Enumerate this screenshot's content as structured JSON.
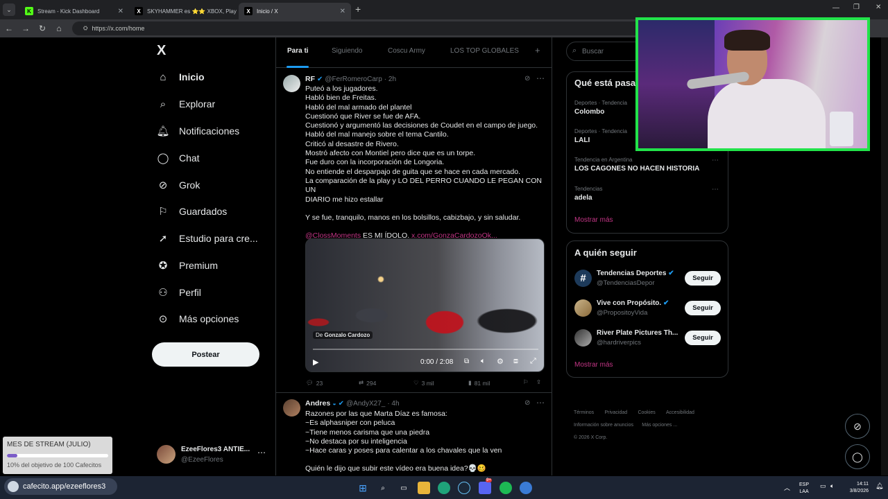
{
  "browser": {
    "tabs": [
      {
        "title": "Stream - Kick Dashboard",
        "icon": "kick-icon",
        "active": false
      },
      {
        "title": "SKYHAMMER es ⭐⭐ XBOX, Play",
        "icon": "x-logo-icon",
        "active": false
      },
      {
        "title": "Inicio / X",
        "icon": "x-logo-icon",
        "active": true
      }
    ],
    "url": "https://x.com/home"
  },
  "sidebar": {
    "logo": "X",
    "items": [
      {
        "label": "Inicio",
        "icon": "home-icon"
      },
      {
        "label": "Explorar",
        "icon": "search-icon"
      },
      {
        "label": "Notificaciones",
        "icon": "bell-icon"
      },
      {
        "label": "Chat",
        "icon": "chat-icon"
      },
      {
        "label": "Grok",
        "icon": "grok-icon"
      },
      {
        "label": "Guardados",
        "icon": "bookmark-icon"
      },
      {
        "label": "Estudio para cre...",
        "icon": "rocket-icon"
      },
      {
        "label": "Premium",
        "icon": "premium-icon"
      },
      {
        "label": "Perfil",
        "icon": "person-icon"
      },
      {
        "label": "Más opciones",
        "icon": "more-circle-icon"
      }
    ],
    "post_button": "Postear",
    "account": {
      "name": "EzeeFlores3 ANTIE...",
      "handle": "@EzeeFlores"
    }
  },
  "feed": {
    "tabs": [
      "Para ti",
      "Siguiendo",
      "Coscu Army",
      "LOS TOP GLOBALES",
      "+"
    ],
    "tweets": [
      {
        "name": "RF",
        "handle": "@FerRomeroCarp",
        "time": "· 2h",
        "lines": [
          "Puteó a los jugadores.",
          "Habló bien de Freitas.",
          "Habló del mal armado del plantel",
          "Cuestionó que River se fue de AFA.",
          "Cuestionó y argumentó las decisiones de Coudet en el campo de juego.",
          "Habló del mal manejo sobre el tema Cantilo.",
          "Criticó al desastre de Rivero.",
          "Mostró afecto con Montiel pero dice que es un torpe.",
          "Fue duro con la incorporación de Longoria.",
          "No entiende el desparpajo de guita que se hace en cada mercado.",
          "La comparación de la play y LO DEL PERRO CUANDO LE PEGAN CON UN",
          "DIARIO me hizo estallar"
        ],
        "extra": "Y se fue, tranquilo, manos en los bolsillos, cabizbajo, y sin saludar.",
        "mention": "@ClossMoments",
        "mention_text": " ES MI ÍDOLO. ",
        "link": "x.com/GonzaCardozoOk...",
        "video": {
          "attribution_prefix": "De",
          "attribution": "Gonzalo Cardozo",
          "time": "0:00 / 2:08"
        },
        "stats": {
          "replies": "23",
          "reposts": "294",
          "likes": "3 mil",
          "views": "81 mil"
        }
      },
      {
        "name": "Andres",
        "handle": "@AndyX27_",
        "time": "· 4h",
        "lines": [
          "Razones por las que Marta Díaz es famosa:",
          "~Es alphasniper con peluca",
          "~Tiene menos carisma que una piedra",
          "~No destaca por su inteligencia",
          "~Hace caras y poses para calentar a los chavales que la ven"
        ],
        "extra": "Quién le dijo que subir este vídeo era buena idea?💀🥴"
      }
    ]
  },
  "right": {
    "search_placeholder": "Buscar",
    "trends_title": "Qué está pasa",
    "trends": [
      {
        "meta": "Deportes · Tendencia",
        "name": "Colombo"
      },
      {
        "meta": "Deportes · Tendencia",
        "name": "LALI"
      },
      {
        "meta": "Tendencia en Argentina",
        "name": "LOS CAGONES NO HACEN HISTORIA"
      },
      {
        "meta": "Tendencias",
        "name": "adela"
      }
    ],
    "trends_more": "Mostrar más",
    "follow_title": "A quién seguir",
    "follow": [
      {
        "name": "Tendencias Deportes",
        "handle": "@TendenciasDepor",
        "button": "Seguir",
        "verified": true
      },
      {
        "name": "Vive con Propósito.",
        "handle": "@PropositoyVida",
        "button": "Seguir",
        "verified": true
      },
      {
        "name": "River Plate Pictures Th...",
        "handle": "@hardriverpics",
        "button": "Seguir",
        "verified": false
      }
    ],
    "follow_more": "Mostrar más",
    "footer": [
      "Términos",
      "Privacidad",
      "Cookies",
      "Accesibilidad",
      "Información sobre anuncios",
      "Más opciones ...",
      "© 2026 X Corp."
    ]
  },
  "widget": {
    "title": "MES DE STREAM (JULIO)",
    "progress": 0.1,
    "text": "10% del objetivo de 100 Cafecitos"
  },
  "taskbar": {
    "overlay": "cafecito.app/ezeeflores3",
    "lang_top": "ESP",
    "lang_bottom": "LAA",
    "time": "14:11",
    "date": "3/8/2026",
    "badge": "9+"
  },
  "colors": {
    "accent": "#1d9bf0",
    "link": "#c13584",
    "cam_border": "#22e34a"
  }
}
